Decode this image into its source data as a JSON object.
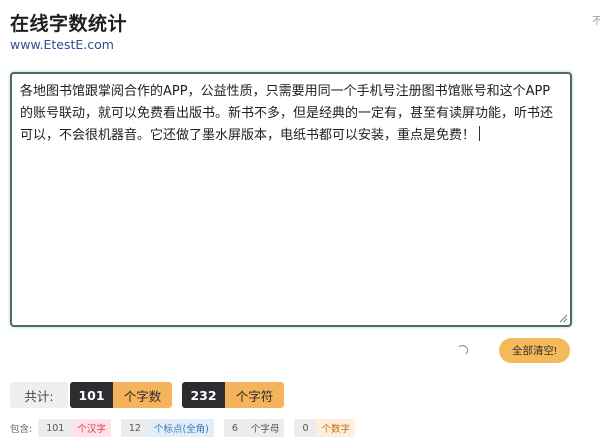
{
  "header": {
    "title": "在线字数统计",
    "url": "www.EtestE.com",
    "corner_text": "不"
  },
  "editor": {
    "text": "各地图书馆跟掌阅合作的APP，公益性质，只需要用同一个手机号注册图书馆账号和这个APP的账号联动，就可以免费看出版书。新书不多，但是经典的一定有，甚至有读屏功能，听书还可以，不会很机器音。它还做了墨水屏版本，电纸书都可以安装，重点是免费！"
  },
  "actions": {
    "clear_label": "全部清空!"
  },
  "stats": {
    "total_label": "共计:",
    "char_count": "101",
    "char_unit": "个字数",
    "byte_count": "232",
    "byte_unit": "个字符"
  },
  "details": {
    "label": "包含:",
    "items": [
      {
        "count": "101",
        "unit": "个汉字",
        "color": "#d9364f"
      },
      {
        "count": "12",
        "unit": "个标点(全角)",
        "color": "#3a77b8"
      },
      {
        "count": "6",
        "unit": "个字母",
        "color": "#555555"
      },
      {
        "count": "0",
        "unit": "个数字",
        "color": "#c76b14"
      }
    ]
  }
}
